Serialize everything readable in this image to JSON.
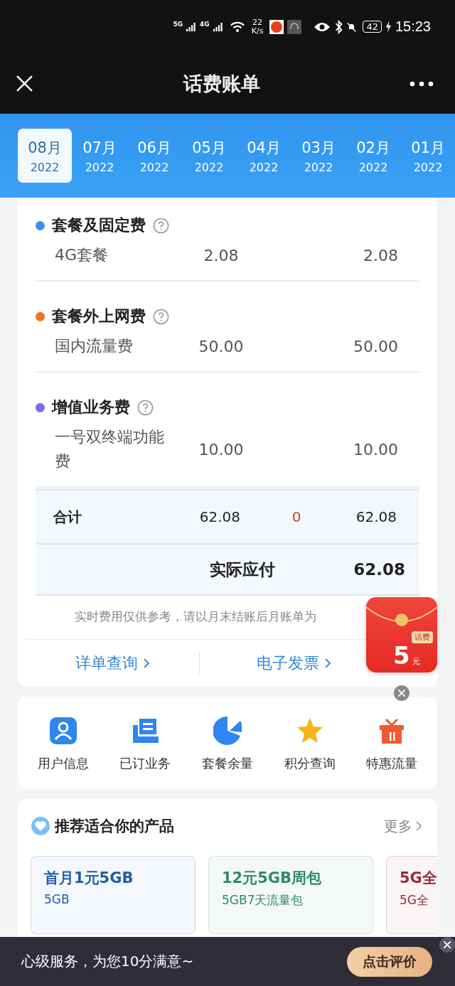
{
  "status_bar": {
    "net1": "5G",
    "net2": "4G",
    "speed_value": "22",
    "speed_unit": "K/s",
    "battery": "42",
    "time": "15:23"
  },
  "header": {
    "title": "话费账单"
  },
  "months": [
    {
      "month": "08月",
      "year": "2022",
      "selected": true
    },
    {
      "month": "07月",
      "year": "2022",
      "selected": false
    },
    {
      "month": "06月",
      "year": "2022",
      "selected": false
    },
    {
      "month": "05月",
      "year": "2022",
      "selected": false
    },
    {
      "month": "04月",
      "year": "2022",
      "selected": false
    },
    {
      "month": "03月",
      "year": "2022",
      "selected": false
    },
    {
      "month": "02月",
      "year": "2022",
      "selected": false
    },
    {
      "month": "01月",
      "year": "2022",
      "selected": false
    }
  ],
  "fee_groups": [
    {
      "title": "套餐及固定费",
      "color": "#3a8ef0",
      "items": [
        {
          "name": "4G套餐",
          "amount": "2.08",
          "payable": "2.08"
        }
      ]
    },
    {
      "title": "套餐外上网费",
      "color": "#f0702a",
      "items": [
        {
          "name": "国内流量费",
          "amount": "50.00",
          "payable": "50.00"
        }
      ]
    },
    {
      "title": "增值业务费",
      "color": "#8066e8",
      "items": [
        {
          "name": "一号双终端功能费",
          "amount": "10.00",
          "payable": "10.00"
        }
      ]
    }
  ],
  "total": {
    "label": "合计",
    "amount": "62.08",
    "discount": "0",
    "payable": "62.08"
  },
  "actual": {
    "label": "实际应付",
    "amount": "62.08"
  },
  "note": "实时费用仅供参考，请以月末结账后月账单为",
  "links": [
    "详单查询",
    "电子发票"
  ],
  "red_packet": {
    "tag": "话费",
    "amount": "5",
    "unit": "元"
  },
  "shortcuts": [
    {
      "label": "用户信息",
      "kind": "user"
    },
    {
      "label": "已订业务",
      "kind": "orders"
    },
    {
      "label": "套餐余量",
      "kind": "pie"
    },
    {
      "label": "积分查询",
      "kind": "star"
    },
    {
      "label": "特惠流量",
      "kind": "gift"
    }
  ],
  "recommend": {
    "title": "推荐适合你的产品",
    "more": "更多",
    "products": [
      {
        "name": "首月1元5GB",
        "desc": "5GB",
        "color": "#1f5fa8"
      },
      {
        "name": "12元5GB周包",
        "desc": "5GB7天流量包",
        "color": "#2e8a66"
      },
      {
        "name": "5G全",
        "desc": "5G全",
        "color": "#9a2b3a"
      }
    ]
  },
  "feedback_bar": {
    "text": "心级服务，为您10分满意~",
    "button": "点击评价"
  }
}
